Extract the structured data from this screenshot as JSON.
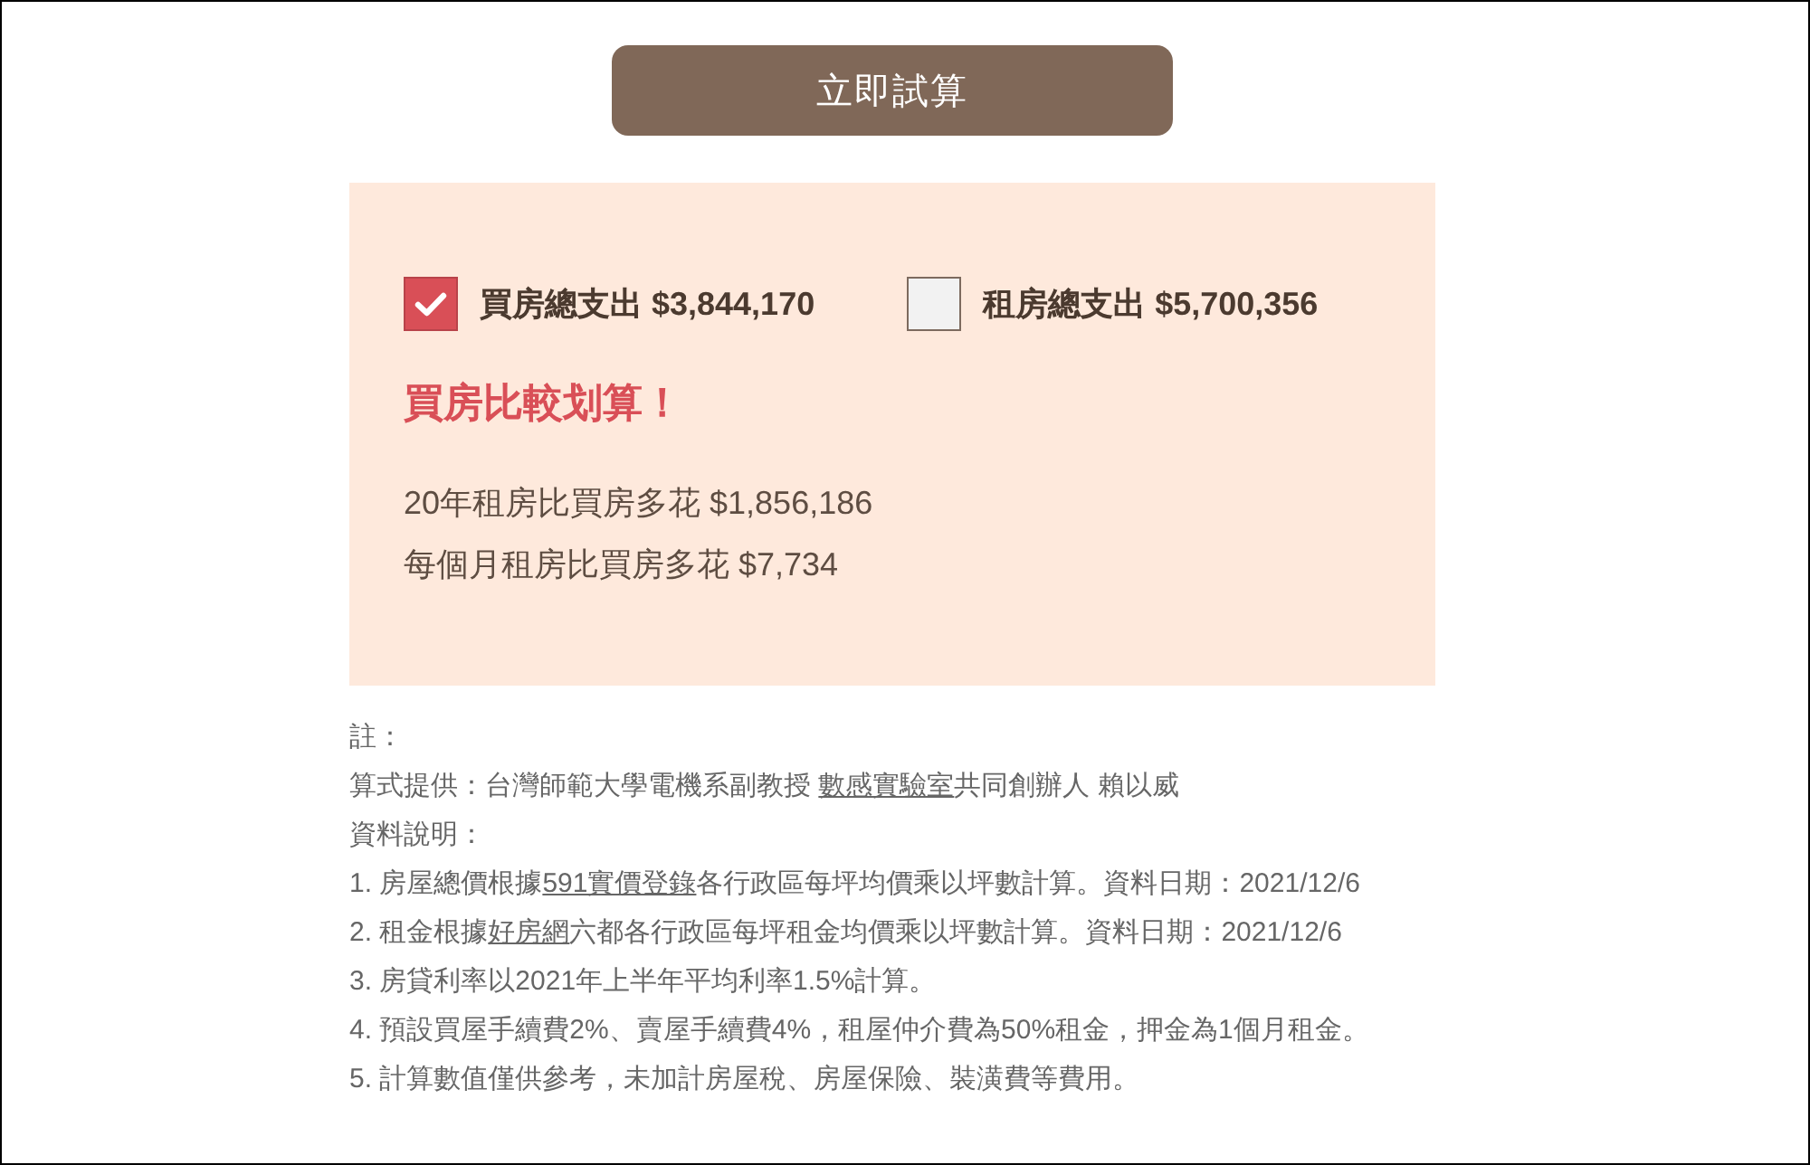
{
  "calculate_button": {
    "label": "立即試算"
  },
  "result": {
    "options": [
      {
        "label": "買房總支出 $3,844,170",
        "checked": true
      },
      {
        "label": "租房總支出 $5,700,356",
        "checked": false
      }
    ],
    "verdict": "買房比較划算！",
    "details": [
      "20年租房比買房多花 $1,856,186",
      "每個月租房比買房多花 $7,734"
    ]
  },
  "notes": {
    "heading": "註：",
    "credit": [
      {
        "kind": "text",
        "text": "算式提供：台灣師範大學電機系副教授 "
      },
      {
        "kind": "link",
        "text": "數感實驗室"
      },
      {
        "kind": "text",
        "text": "共同創辦人 賴以威"
      }
    ],
    "data_heading": "資料說明：",
    "items": [
      [
        {
          "kind": "text",
          "text": "1. 房屋總價根據"
        },
        {
          "kind": "link",
          "text": "591實價登錄"
        },
        {
          "kind": "text",
          "text": "各行政區每坪均價乘以坪數計算。資料日期：2021/12/6"
        }
      ],
      [
        {
          "kind": "text",
          "text": "2. 租金根據"
        },
        {
          "kind": "link",
          "text": "好房網"
        },
        {
          "kind": "text",
          "text": "六都各行政區每坪租金均價乘以坪數計算。資料日期：2021/12/6"
        }
      ],
      [
        {
          "kind": "text",
          "text": "3. 房貸利率以2021年上半年平均利率1.5%計算。"
        }
      ],
      [
        {
          "kind": "text",
          "text": "4. 預設買屋手續費2%、賣屋手續費4%，租屋仲介費為50%租金，押金為1個月租金。"
        }
      ],
      [
        {
          "kind": "text",
          "text": "5. 計算數值僅供參考，未加計房屋稅、房屋保險、裝潢費等費用。"
        }
      ]
    ]
  }
}
